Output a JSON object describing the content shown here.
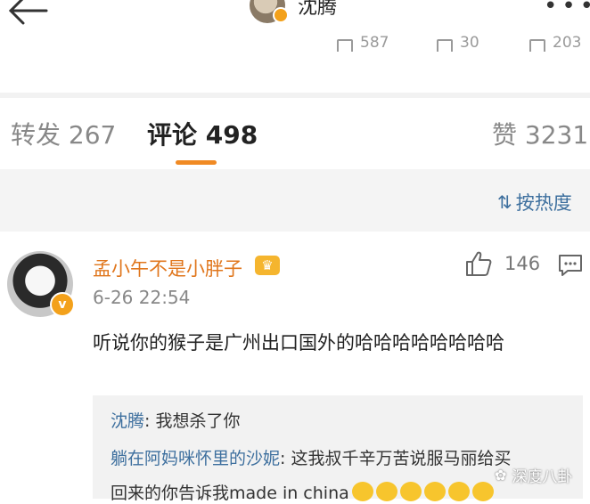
{
  "header": {
    "title": "沈腾",
    "back_icon": "back-arrow-icon",
    "more_icon": "more-dots-icon",
    "more_glyph": "•••"
  },
  "post_actions": {
    "repost": "587",
    "comment": "30",
    "like": "203"
  },
  "tabs": {
    "repost_label": "转发",
    "repost_count": "267",
    "comment_label": "评论",
    "comment_count": "498",
    "like_label": "赞",
    "like_count": "3231",
    "active_color": "#f08a24"
  },
  "sort": {
    "label": "按热度",
    "icon": "sort-icon"
  },
  "comment": {
    "username": "孟小午不是小胖子",
    "time": "6-26 22:54",
    "like_count": "146",
    "text": "听说你的猴子是广州出口国外的哈哈哈哈哈哈哈哈",
    "verified_glyph": "v",
    "crown_glyph": "♛"
  },
  "replies": [
    {
      "name": "沈腾",
      "sep": ": ",
      "text": "我想杀了你"
    },
    {
      "name": "躺在阿妈咪怀里的沙妮",
      "sep": ": ",
      "text": "这我叔千辛万苦说服马丽给买"
    },
    {
      "name": "",
      "sep": "",
      "text": "回来的你告诉我made in china"
    }
  ],
  "watermark": {
    "text": "深度八卦",
    "icon": "wechat-icon"
  },
  "colors": {
    "link_blue": "#3d6f9e",
    "username_orange": "#e0761c",
    "vip_gold": "#f3a11b"
  }
}
